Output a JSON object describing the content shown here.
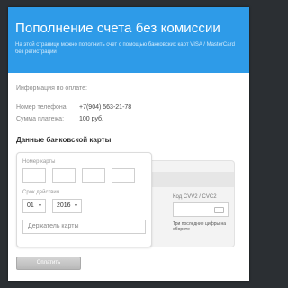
{
  "header": {
    "title": "Пополнение счета без комиссии",
    "description": "На этой странице можно пополнить счет с помощью банковских карт VISA / MasterCard без регистрации"
  },
  "payment_info": {
    "heading": "Информация по оплате:",
    "phone_label": "Номер телефона:",
    "phone_value": "+7(904) 563-21-78",
    "sum_label": "Сумма платежа:",
    "sum_value": "100 руб."
  },
  "card": {
    "section_title": "Данные банковской карты",
    "number_label": "Номер карты",
    "expiry_label": "Срок действия",
    "month_value": "01",
    "year_value": "2016",
    "holder_placeholder": "Держатель карты",
    "cvc_label": "Код CVV2 / CVC2",
    "cvc_hint": "Три последние цифры на обороте"
  },
  "actions": {
    "pay_label": "Оплатить"
  },
  "colors": {
    "header_bg": "#2e9be8",
    "page_bg": "#2b2f33"
  },
  "icons": {
    "card": "card-icon",
    "dropdown": "chevron-down-icon"
  }
}
